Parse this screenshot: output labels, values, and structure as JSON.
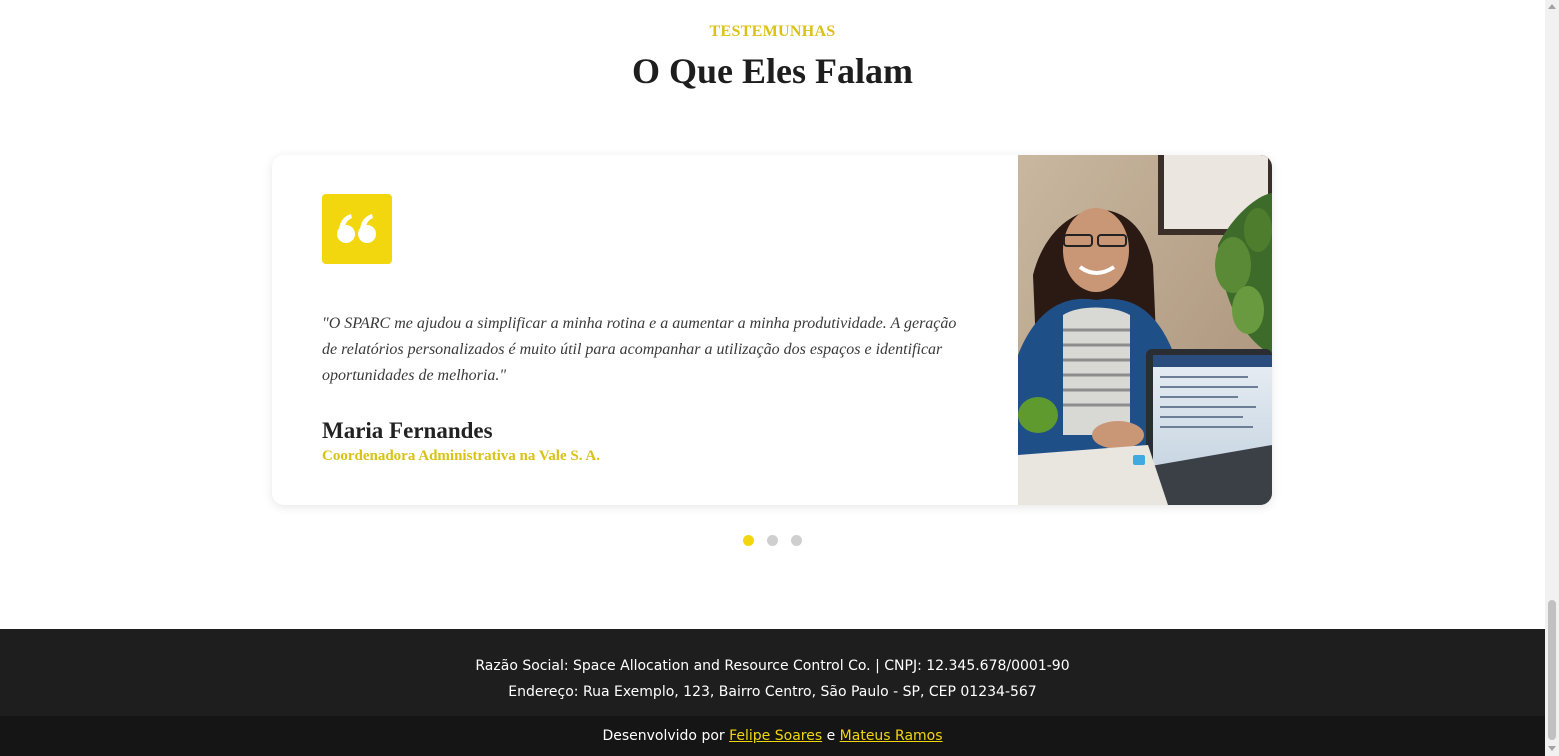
{
  "testimonials": {
    "eyebrow": "TESTEMUNHAS",
    "title": "O Que Eles Falam",
    "active": {
      "quote": "\"O SPARC me ajudou a simplificar a minha rotina e a aumentar a minha produtividade. A geração de relatórios personalizados é muito útil para acompanhar a utilização dos espaços e identificar oportunidades de melhoria.\"",
      "name": "Maria Fernandes",
      "role": "Coordenadora Administrativa na Vale S. A."
    },
    "slides_total": 3,
    "active_slide": 1
  },
  "footer": {
    "company_line": "Razão Social: Space Allocation and Resource Control Co. | CNPJ: 12.345.678/0001-90",
    "address_line": "Endereço: Rua Exemplo, 123, Bairro Centro, São Paulo - SP, CEP 01234-567"
  },
  "subfooter": {
    "prefix": "Desenvolvido por",
    "author1": "Felipe Soares",
    "joiner": "e",
    "author2": "Mateus Ramos"
  },
  "colors": {
    "accent": "#f2d70f",
    "accent_text": "#d9c213",
    "footer_bg": "#1e1e1f",
    "subfooter_bg": "#151515"
  },
  "icons": {
    "quote": "quote-icon"
  }
}
